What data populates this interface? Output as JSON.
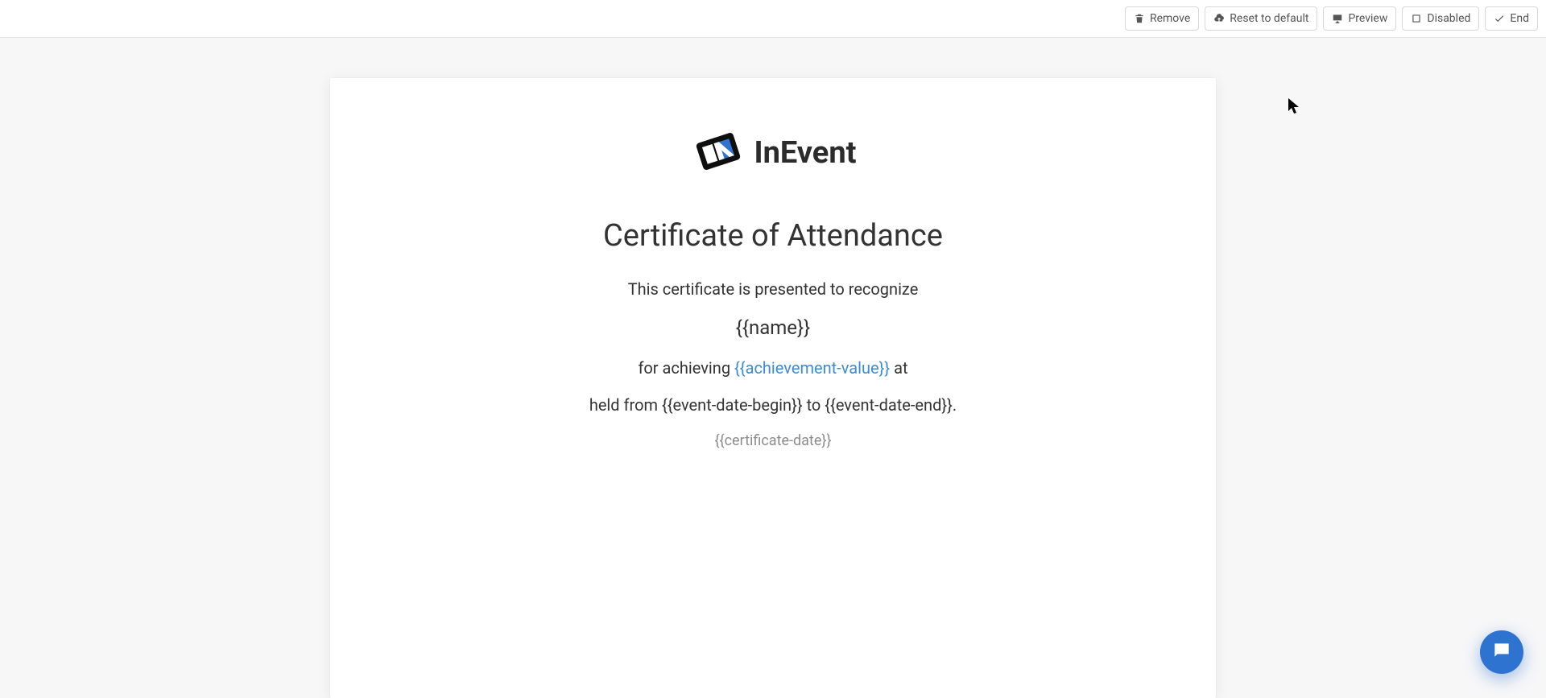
{
  "toolbar": {
    "remove_label": "Remove",
    "reset_label": "Reset to default",
    "preview_label": "Preview",
    "disabled_label": "Disabled",
    "end_label": "End"
  },
  "brand": {
    "name": "InEvent"
  },
  "certificate": {
    "title": "Certificate of Attendance",
    "intro": "This certificate is presented to recognize",
    "name_placeholder": "{{name}}",
    "achieving_prefix": "for achieving ",
    "achievement_placeholder": "{{achievement-value}}",
    "achieving_suffix": " at",
    "held_line": "held from {{event-date-begin}} to {{event-date-end}}.",
    "cert_date_placeholder": "{{certificate-date}}"
  },
  "icons": {
    "remove": "trash-icon",
    "reset": "cloud-upload-icon",
    "preview": "monitor-icon",
    "disabled": "square-icon",
    "end": "check-icon",
    "help": "chat-icon"
  }
}
